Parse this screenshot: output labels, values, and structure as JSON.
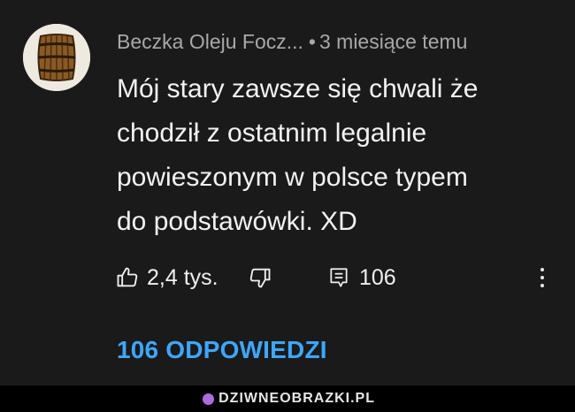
{
  "comment": {
    "author": "Beczka Oleju Focz...",
    "separator": "•",
    "time": "3 miesiące temu",
    "lines": [
      "Mój stary zawsze się chwali że",
      "chodził z ostatnim legalnie",
      "powieszonym w polsce typem",
      "do podstawówki. XD"
    ]
  },
  "actions": {
    "like_count": "2,4 tys.",
    "reply_count": "106",
    "like_icon": "thumbs-up-icon",
    "dislike_icon": "thumbs-down-icon",
    "comment_icon": "comment-icon",
    "menu_icon": "more-vert-icon"
  },
  "replies_label": "106 ODPOWIEDZI",
  "watermark": "DZIWNEOBRAZKI.PL",
  "colors": {
    "background": "#1a1a1a",
    "accent": "#3ea6ff",
    "meta_text": "#a8a8a8"
  }
}
